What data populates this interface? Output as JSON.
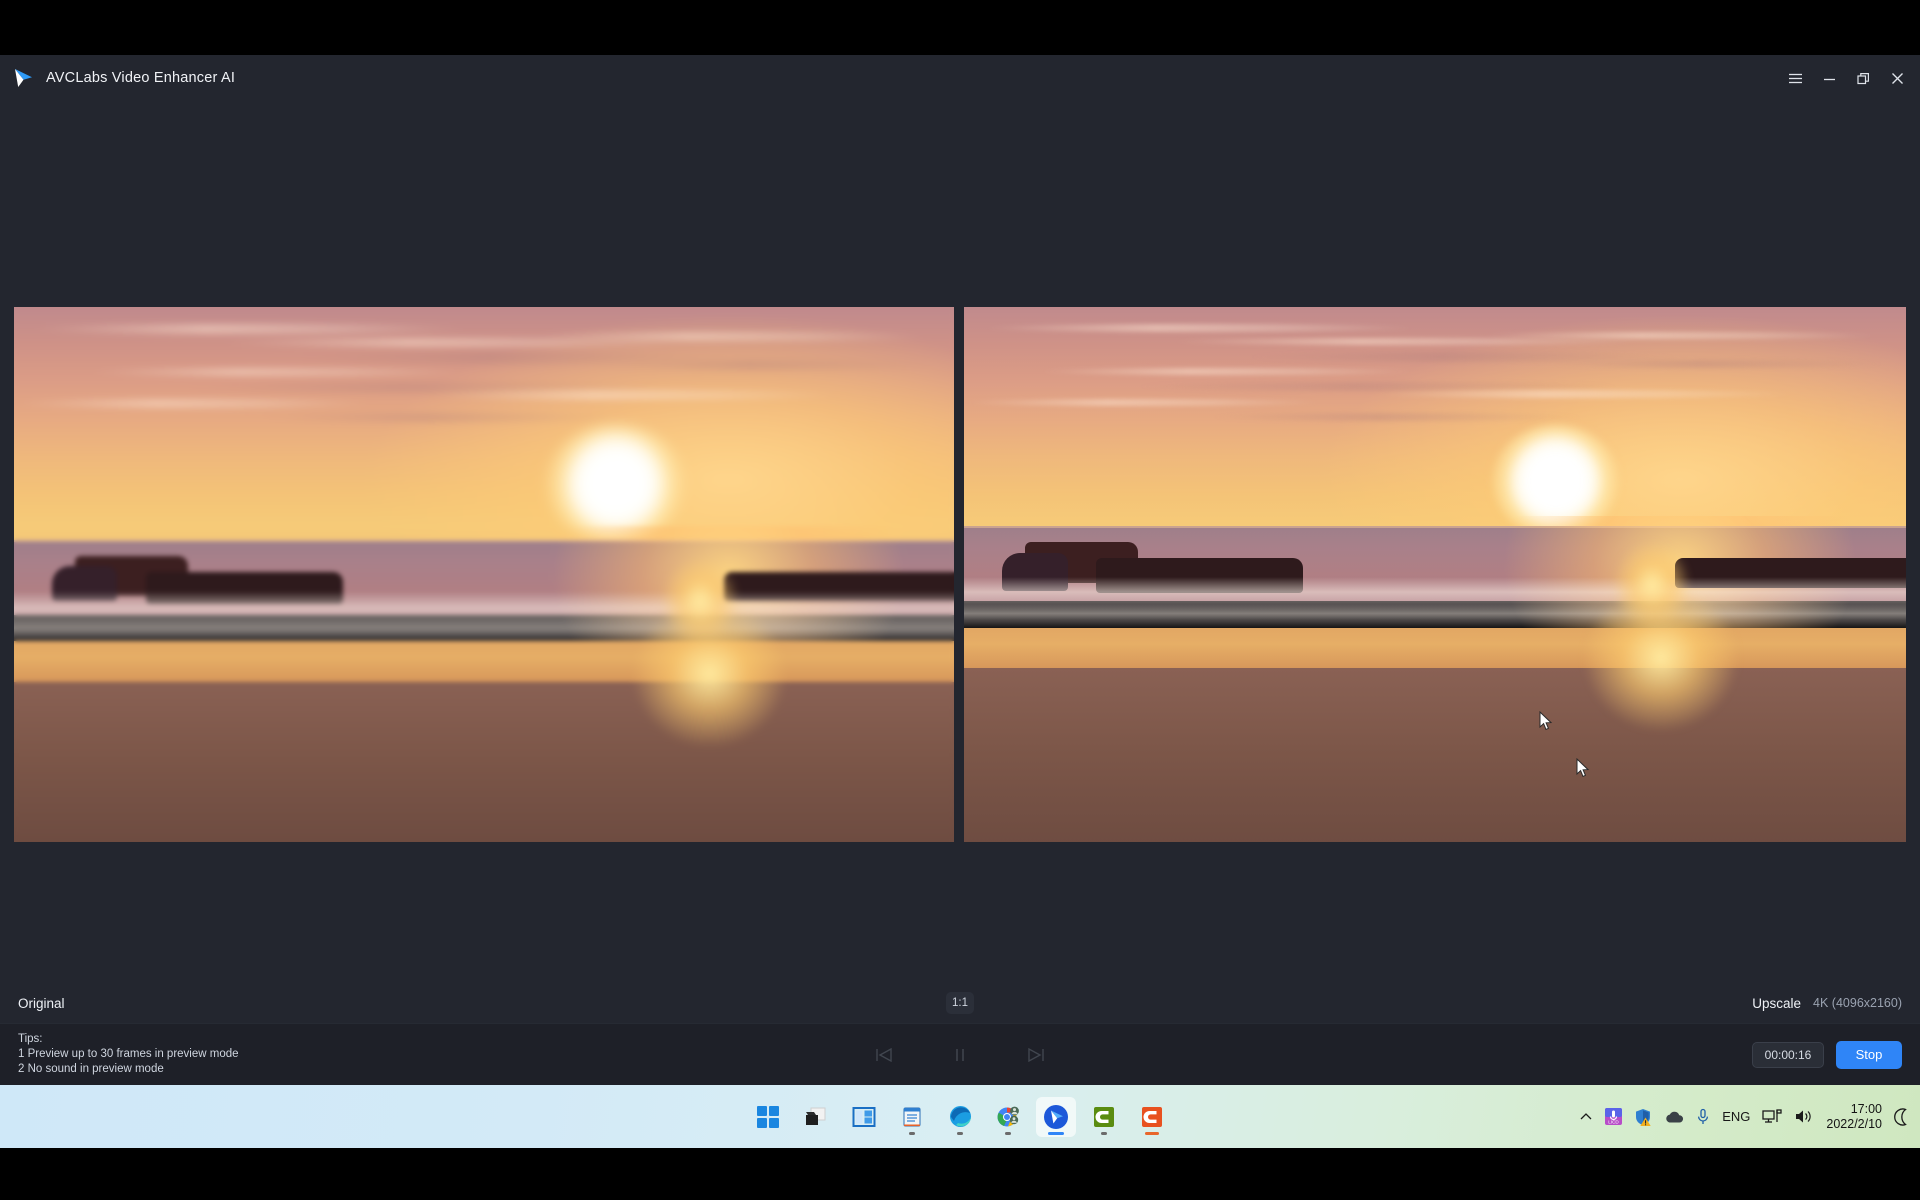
{
  "app": {
    "title": "AVCLabs Video Enhancer AI",
    "logo_icon": "play-triangle-logo",
    "window_controls": [
      {
        "name": "menu-icon",
        "label": "☰"
      },
      {
        "name": "minimize-icon",
        "label": "−"
      },
      {
        "name": "restore-icon",
        "label": "❐"
      },
      {
        "name": "close-icon",
        "label": "✕"
      }
    ]
  },
  "preview": {
    "left_pane_name": "original-video-preview",
    "right_pane_name": "upscaled-video-preview"
  },
  "meta": {
    "original_label": "Original",
    "ratio_label": "1:1",
    "upscale_label": "Upscale",
    "upscale_value": "4K (4096x2160)"
  },
  "bottom": {
    "tips_title": "Tips:",
    "tip_1": "1 Preview up to 30 frames in preview mode",
    "tip_2": "2 No sound in preview mode",
    "prev_icon": "skip-previous-icon",
    "pause_icon": "pause-icon",
    "next_icon": "skip-next-icon",
    "timer": "00:00:16",
    "stop_label": "Stop"
  },
  "taskbar": {
    "items": [
      {
        "name": "start-button",
        "icon": "windows-logo-icon",
        "running": false
      },
      {
        "name": "file-explorer-button",
        "icon": "file-explorer-icon",
        "running": false
      },
      {
        "name": "widgets-button",
        "icon": "widgets-icon",
        "running": false
      },
      {
        "name": "notepad-button",
        "icon": "notepad-icon",
        "running": true
      },
      {
        "name": "edge-button",
        "icon": "edge-browser-icon",
        "running": true
      },
      {
        "name": "chrome-button",
        "icon": "chrome-browser-icon",
        "running": true
      },
      {
        "name": "avclabs-button",
        "icon": "avclabs-icon",
        "running": true,
        "active": true
      },
      {
        "name": "camtasia-button",
        "icon": "green-c-app-icon",
        "running": true
      },
      {
        "name": "snagit-button",
        "icon": "orange-c-app-icon",
        "running": true
      }
    ],
    "tray": {
      "overflow_icon": "chevron-up-icon",
      "app_icon": "purple-app-tray-icon",
      "security_icon": "security-shield-warning-icon",
      "cloud_icon": "onedrive-cloud-icon",
      "mic_icon": "microphone-icon",
      "language": "ENG",
      "network_icon": "network-icon",
      "volume_icon": "volume-icon",
      "time": "17:00",
      "date": "2022/2/10",
      "notification_icon": "do-not-disturb-moon-icon"
    }
  },
  "colors": {
    "window_bg": "#23262f",
    "bottom_bg": "#1e2028",
    "accent": "#2f85f7",
    "text_primary": "#eef1f6",
    "text_muted": "#9aa2b0"
  }
}
